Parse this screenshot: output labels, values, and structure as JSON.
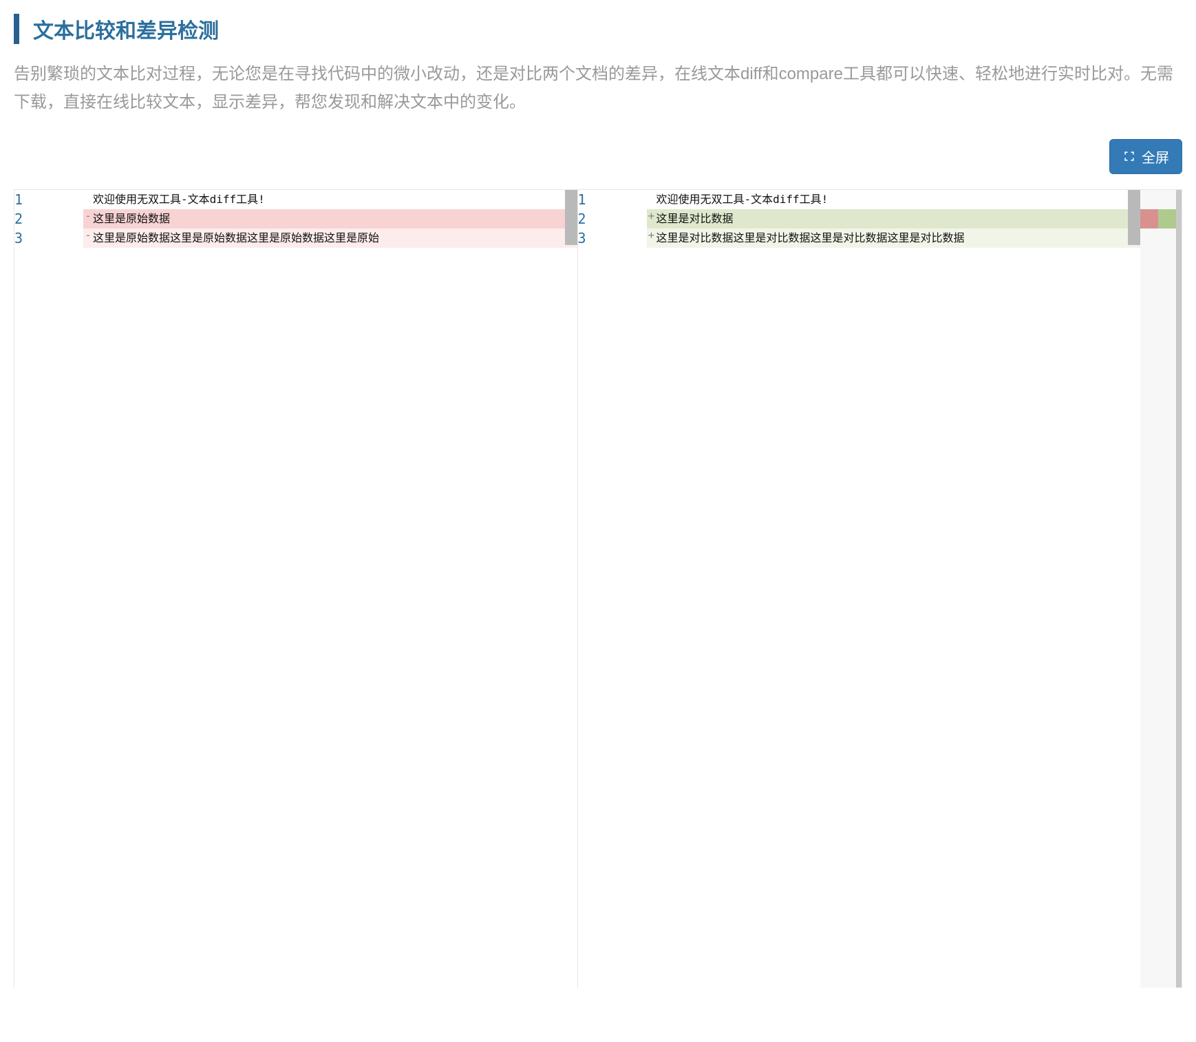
{
  "header": {
    "title": "文本比较和差异检测",
    "description": "告别繁琐的文本比对过程，无论您是在寻找代码中的微小改动，还是对比两个文档的差异，在线文本diff和compare工具都可以快速、轻松地进行实时比对。无需下载，直接在线比较文本，显示差异，帮您发现和解决文本中的变化。"
  },
  "toolbar": {
    "fullscreen_label": "全屏"
  },
  "diff": {
    "left": {
      "lines": [
        {
          "no": "1",
          "marker": "",
          "text": "欢迎使用无双工具-文本diff工具!",
          "type": "same"
        },
        {
          "no": "2",
          "marker": "-",
          "text": "这里是原始数据",
          "type": "removed"
        },
        {
          "no": "3",
          "marker": "-",
          "text": "这里是原始数据这里是原始数据这里是原始数据这里是原始",
          "type": "removed-light"
        }
      ]
    },
    "right": {
      "lines": [
        {
          "no": "1",
          "marker": "",
          "text": "欢迎使用无双工具-文本diff工具!",
          "type": "same"
        },
        {
          "no": "2",
          "marker": "+",
          "text": "这里是对比数据",
          "type": "added"
        },
        {
          "no": "3",
          "marker": "+",
          "text": "这里是对比数据这里是对比数据这里是对比数据这里是对比数据",
          "type": "added-light"
        }
      ]
    }
  }
}
